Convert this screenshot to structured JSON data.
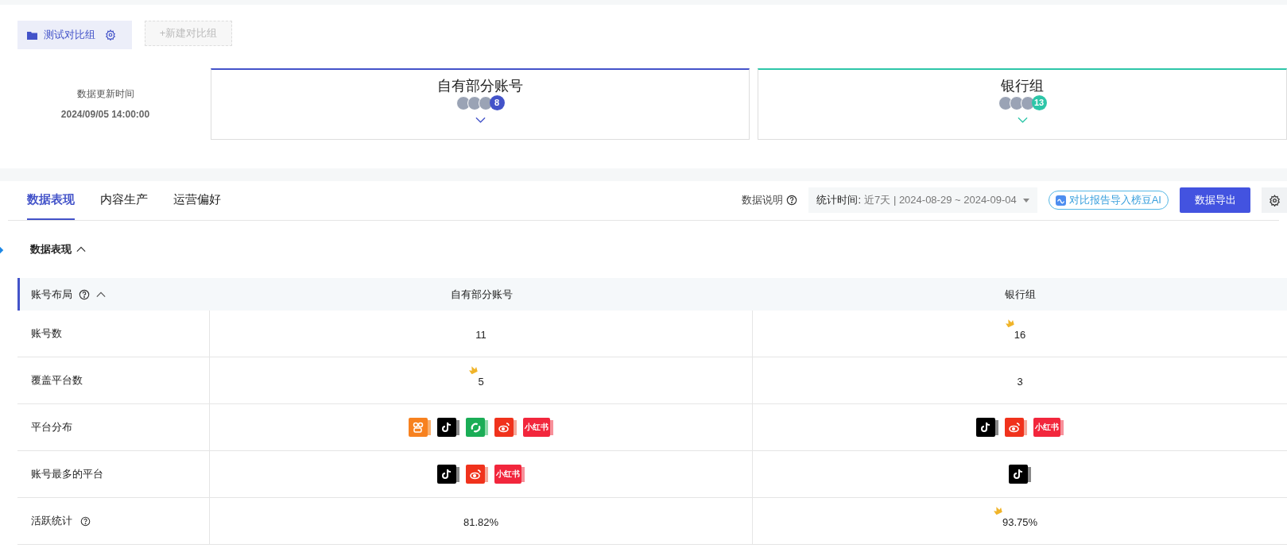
{
  "group_button": {
    "label": "测试对比组"
  },
  "new_group_button": {
    "label": "+新建对比组",
    "disabled": true
  },
  "update_info": {
    "label": "数据更新时间",
    "time": "2024/09/05 14:00:00"
  },
  "groups": [
    {
      "name": "自有部分账号",
      "color": "#4353c9",
      "count": "8"
    },
    {
      "name": "银行组",
      "color": "#2dc6a8",
      "count": "13"
    }
  ],
  "tabs": [
    {
      "label": "数据表现",
      "selected": true
    },
    {
      "label": "内容生产",
      "selected": false
    },
    {
      "label": "运营偏好",
      "selected": false
    }
  ],
  "toolbar": {
    "help": "数据说明",
    "period_label": "统计时间:",
    "period_value": "近7天 | 2024-08-29 ~ 2024-09-04",
    "ai_button": "对比报告导入榜豆AI",
    "export_button": "数据导出"
  },
  "section": {
    "title": "数据表现",
    "expanded": true
  },
  "table": {
    "title": "账号布局",
    "expanded": true,
    "columns": [
      "自有部分账号",
      "银行组"
    ],
    "rows": [
      {
        "label": "账号数",
        "kind": "text",
        "help": false,
        "cells": [
          {
            "text": "11",
            "top": false
          },
          {
            "text": "16",
            "top": true
          }
        ]
      },
      {
        "label": "覆盖平台数",
        "kind": "text",
        "help": false,
        "cells": [
          {
            "text": "5",
            "top": true
          },
          {
            "text": "3",
            "top": false
          }
        ]
      },
      {
        "label": "平台分布",
        "kind": "platforms",
        "help": false,
        "cells": [
          {
            "platforms": [
              {
                "kind": "kuaishou"
              },
              {
                "kind": "douyin"
              },
              {
                "kind": "wechat"
              },
              {
                "kind": "weibo"
              },
              {
                "kind": "xiaohongshu",
                "text": "小红书"
              }
            ]
          },
          {
            "platforms": [
              {
                "kind": "douyin"
              },
              {
                "kind": "weibo"
              },
              {
                "kind": "xiaohongshu",
                "text": "小红书"
              }
            ]
          }
        ]
      },
      {
        "label": "账号最多的平台",
        "kind": "platforms",
        "help": false,
        "cells": [
          {
            "platforms": [
              {
                "kind": "douyin"
              },
              {
                "kind": "weibo"
              },
              {
                "kind": "xiaohongshu",
                "text": "小红书"
              }
            ]
          },
          {
            "platforms": [
              {
                "kind": "douyin"
              }
            ]
          }
        ]
      },
      {
        "label": "活跃统计",
        "kind": "text",
        "help": true,
        "cells": [
          {
            "text": "81.82%",
            "top": false
          },
          {
            "text": "93.75%",
            "top": true
          }
        ]
      }
    ]
  }
}
